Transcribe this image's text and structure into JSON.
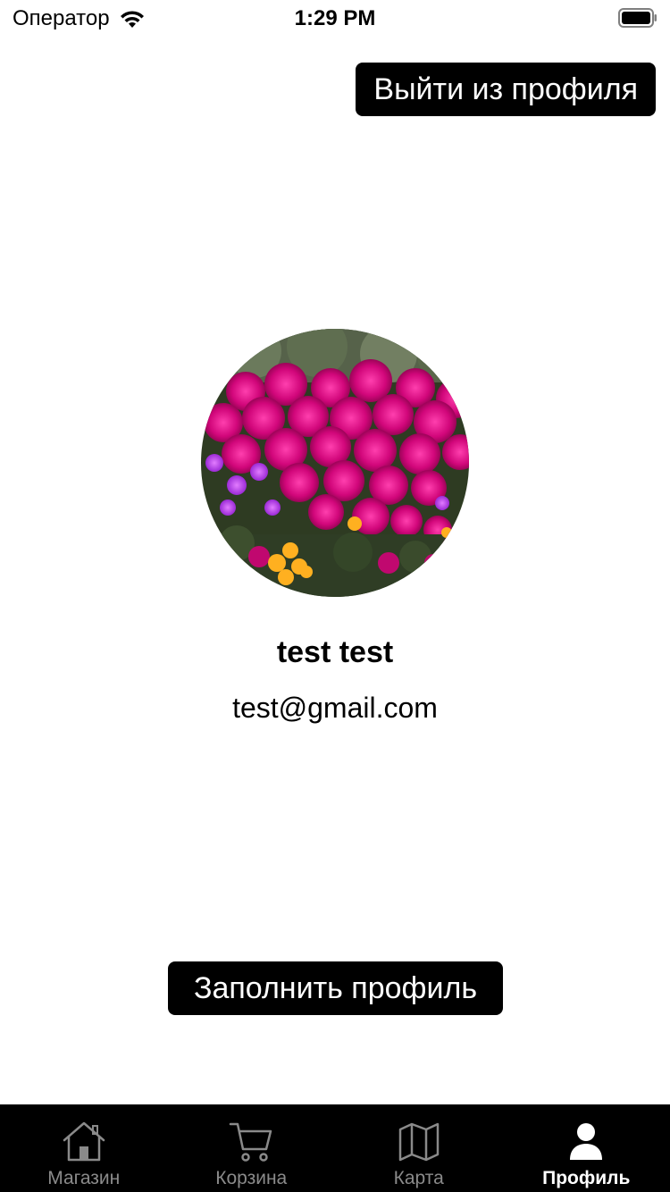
{
  "status_bar": {
    "carrier": "Оператор",
    "time": "1:29 PM",
    "icons": [
      "wifi-icon",
      "battery-icon"
    ]
  },
  "header": {
    "logout_label": "Выйти из профиля"
  },
  "profile": {
    "avatar": "flowers-photo",
    "name": "test test",
    "email": "test@gmail.com"
  },
  "actions": {
    "fill_profile_label": "Заполнить профиль"
  },
  "tab_bar": {
    "active": "Профиль",
    "items": [
      {
        "label": "Магазин",
        "icon": "home-icon"
      },
      {
        "label": "Корзина",
        "icon": "cart-icon"
      },
      {
        "label": "Карта",
        "icon": "map-icon"
      },
      {
        "label": "Профиль",
        "icon": "user-icon"
      }
    ]
  },
  "colors": {
    "background": "#ffffff",
    "button": "#000000",
    "button_text": "#ffffff",
    "tab_bar": "#000000",
    "tab_inactive": "#8a8a8a",
    "tab_active": "#ffffff"
  }
}
